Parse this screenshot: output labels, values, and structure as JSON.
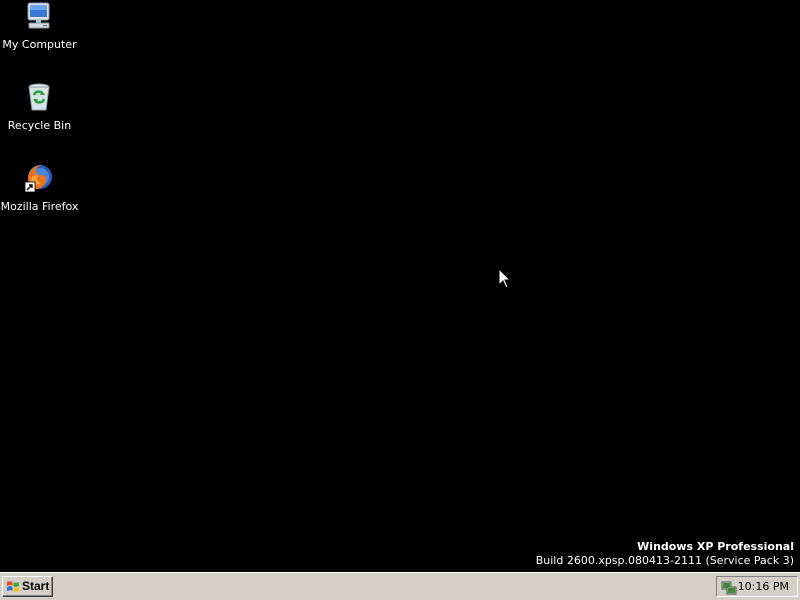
{
  "desktop": {
    "background_color": "#000000",
    "icons": [
      {
        "label": "My Computer",
        "icon": "my-computer-icon"
      },
      {
        "label": "Recycle Bin",
        "icon": "recycle-bin-icon"
      },
      {
        "label": "Mozilla Firefox",
        "icon": "firefox-shortcut-icon"
      }
    ],
    "watermark": {
      "title": "Windows XP Professional",
      "build": "Build 2600.xpsp.080413-2111 (Service Pack 3)"
    }
  },
  "taskbar": {
    "start_label": "Start",
    "start_icon": "windows-logo-icon",
    "tray_icon": "network-status-icon",
    "clock": "10:16 PM",
    "background_color": "#d4d0c8"
  }
}
